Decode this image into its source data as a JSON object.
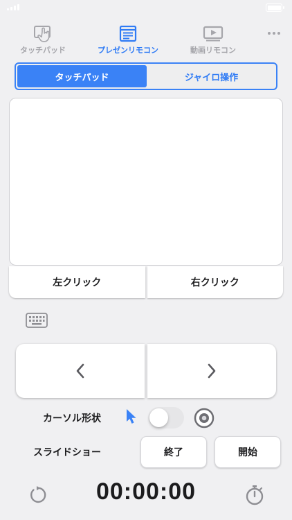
{
  "tabs": [
    {
      "label": "タッチパッド",
      "icon": "touch-hand-icon",
      "active": false
    },
    {
      "label": "プレゼンリモコン",
      "icon": "presentation-document-icon",
      "active": true
    },
    {
      "label": "動画リモコン",
      "icon": "video-play-icon",
      "active": false
    }
  ],
  "more_icon": "more-dots-icon",
  "mode_segments": [
    {
      "label": "タッチパッド",
      "active": true
    },
    {
      "label": "ジャイロ操作",
      "active": false
    }
  ],
  "clicks": {
    "left_label": "左クリック",
    "right_label": "右クリック"
  },
  "keyboard_icon": "keyboard-icon",
  "slide_nav": {
    "prev_icon": "chevron-left-icon",
    "next_icon": "chevron-right-icon"
  },
  "cursor": {
    "label": "カーソル形状",
    "toggle_on": false
  },
  "slideshow": {
    "label": "スライドショー",
    "end_label": "終了",
    "start_label": "開始"
  },
  "timer": {
    "value": "00:00:00"
  },
  "colors": {
    "accent": "#3a82f6",
    "inactive": "#a6a6ab",
    "background": "#f0f0f2"
  }
}
